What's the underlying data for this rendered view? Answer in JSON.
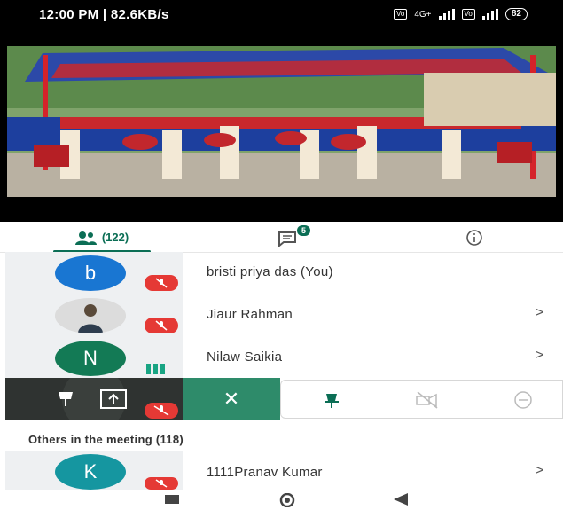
{
  "status_bar": {
    "time_speed": "12:00 PM | 82.6KB/s",
    "network1": "4G+",
    "battery": "82"
  },
  "tabs": {
    "people_count": "(122)",
    "chat_badge": "5"
  },
  "participants": [
    {
      "initial": "b",
      "name": "bristi priya das (You)",
      "avatar_color": "#1976d2"
    },
    {
      "initial": "",
      "name": "Jiaur Rahman",
      "avatar_color": "#e0e0e0"
    },
    {
      "initial": "N",
      "name": "Nilaw Saikia",
      "avatar_color": "#137a55"
    }
  ],
  "others_section": {
    "title": "Others in the meeting (118)",
    "participants": [
      {
        "initial": "K",
        "name": "1111Pranav Kumar",
        "avatar_color": "#1596a0"
      }
    ]
  },
  "colors": {
    "accent": "#0b6e55",
    "muted_red": "#e53935"
  }
}
